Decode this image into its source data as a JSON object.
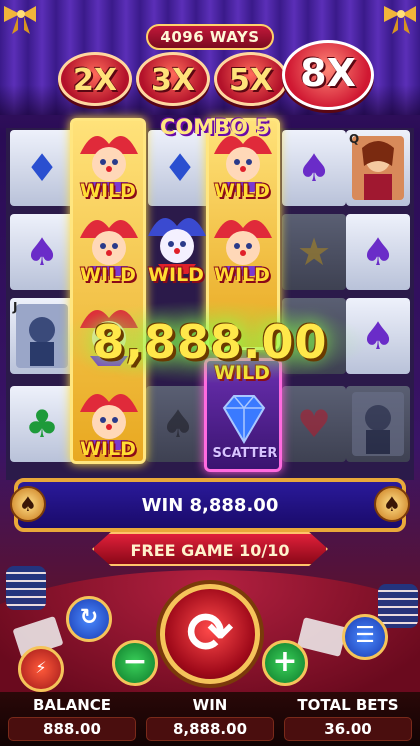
{
  "header": {
    "ways": "4096 WAYS"
  },
  "multipliers": [
    {
      "label": "2X",
      "active": false
    },
    {
      "label": "3X",
      "active": false
    },
    {
      "label": "5X",
      "active": false
    },
    {
      "label": "8X",
      "active": true
    }
  ],
  "combo": "COMBO 5",
  "reels": {
    "wild_label": "WILD",
    "scatter_label": "SCATTER",
    "card_letters": {
      "queen": "Q",
      "jack": "J"
    }
  },
  "big_win": "8,888.00",
  "win_bar": {
    "text": "WIN 8,888.00"
  },
  "free_game": {
    "text": "FREE GAME 10/10"
  },
  "controls": {
    "minus": "−",
    "plus": "+",
    "spin_icon": "refresh-arrows-icon",
    "autoplay_icon": "play-circle-icon",
    "menu_icon": "hamburger-menu-icon",
    "turbo_icon": "lightning-icon"
  },
  "footer": {
    "balance_label": "BALANCE",
    "balance_value": "888.00",
    "win_label": "WIN",
    "win_value": "8,888.00",
    "total_bets_label": "TOTAL BETS",
    "total_bets_value": "36.00"
  },
  "colors": {
    "gold": "#ffe27a",
    "red": "#c2183a",
    "felt": "#8a0e24",
    "win_bar": "#2a1a9a"
  }
}
